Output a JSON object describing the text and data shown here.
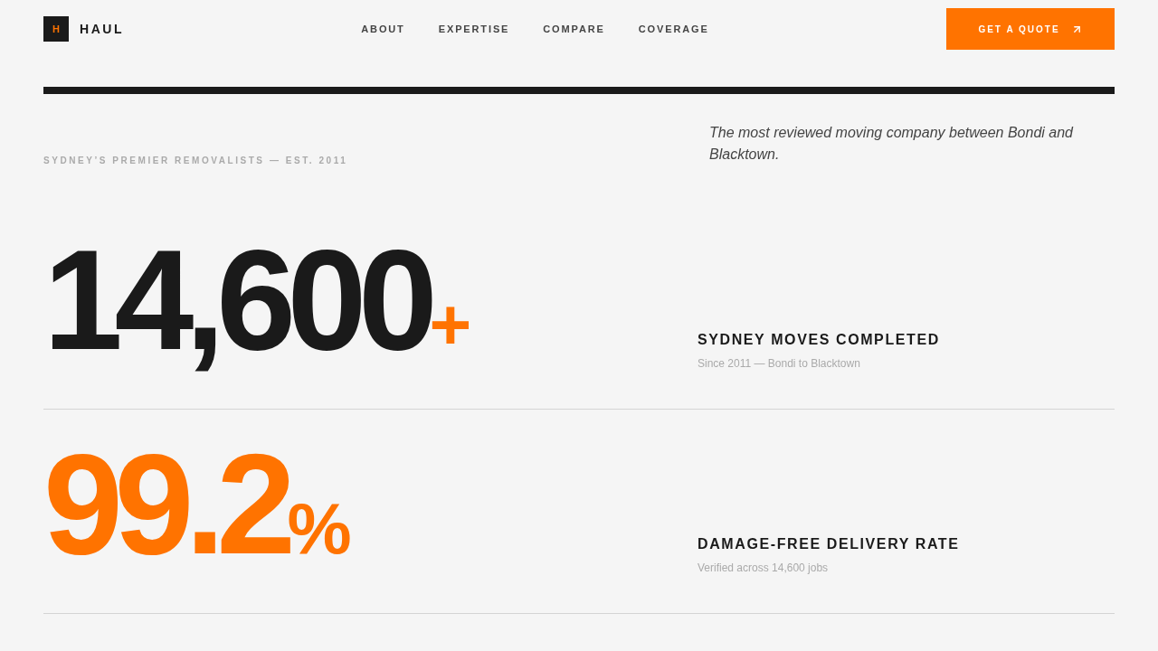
{
  "header": {
    "logo": {
      "mark": "H",
      "name": "HAUL"
    },
    "nav": [
      {
        "label": "ABOUT"
      },
      {
        "label": "EXPERTISE"
      },
      {
        "label": "COMPARE"
      },
      {
        "label": "COVERAGE"
      }
    ],
    "cta": {
      "label": "GET A QUOTE"
    }
  },
  "hero": {
    "eyebrow": "SYDNEY’S PREMIER REMOVALISTS — EST. 2011",
    "tagline": "The most reviewed moving company between Bondi and Blacktown."
  },
  "stats": [
    {
      "value": "14,600",
      "suffix": "+",
      "highlighted": false,
      "label": "SYDNEY MOVES COMPLETED",
      "note": "Since 2011 — Bondi to Blacktown"
    },
    {
      "value": "99.2",
      "suffix": "%",
      "highlighted": true,
      "label": "DAMAGE-FREE DELIVERY RATE",
      "note": "Verified across 14,600 jobs"
    }
  ]
}
